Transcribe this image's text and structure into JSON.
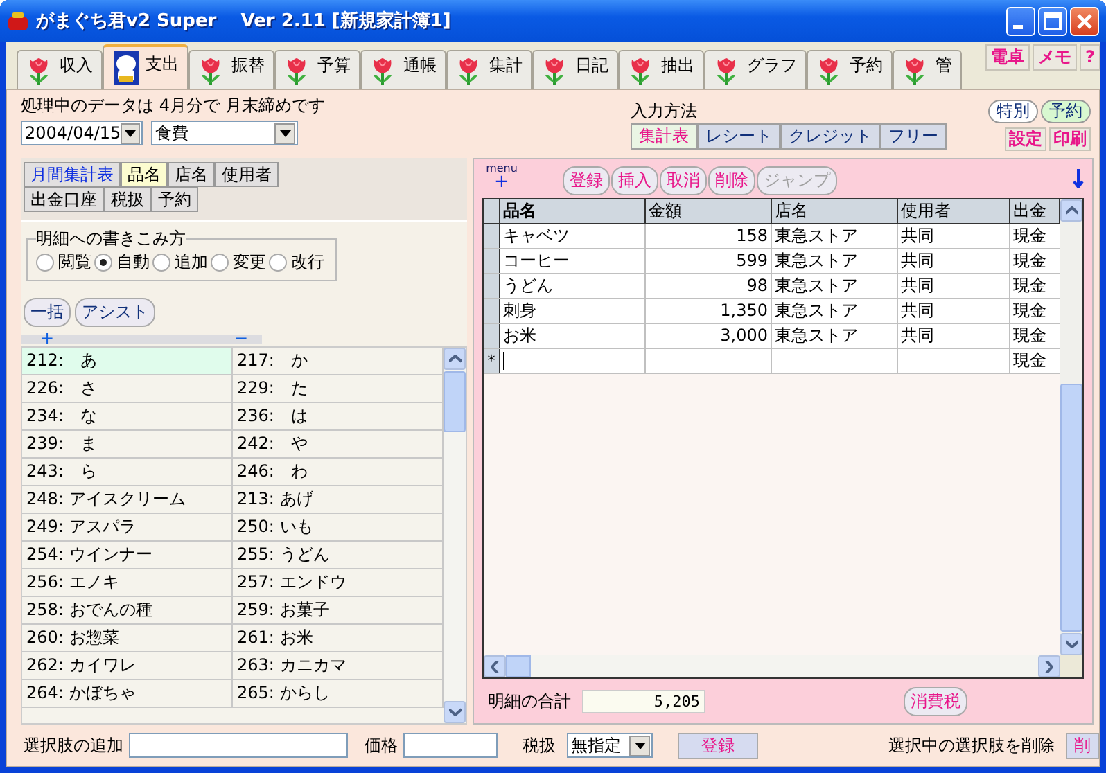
{
  "window": {
    "title": "がまぐち君v2 Super　 Ver 2.11 [新規家計簿1]"
  },
  "tabs": [
    {
      "label": "収入",
      "selected": false,
      "kind": "tulip"
    },
    {
      "label": "支出",
      "selected": true,
      "kind": "figurine"
    },
    {
      "label": "振替",
      "selected": false,
      "kind": "tulip"
    },
    {
      "label": "予算",
      "selected": false,
      "kind": "tulip"
    },
    {
      "label": "通帳",
      "selected": false,
      "kind": "tulip"
    },
    {
      "label": "集計",
      "selected": false,
      "kind": "tulip"
    },
    {
      "label": "日記",
      "selected": false,
      "kind": "tulip"
    },
    {
      "label": "抽出",
      "selected": false,
      "kind": "tulip"
    },
    {
      "label": "グラフ",
      "selected": false,
      "kind": "tulip"
    },
    {
      "label": "予約",
      "selected": false,
      "kind": "tulip"
    },
    {
      "label": "管",
      "selected": false,
      "kind": "tulip"
    }
  ],
  "tool_buttons": [
    "電卓",
    "メモ",
    "?"
  ],
  "status_text": "処理中のデータは 4月分で 月末締めです",
  "date_select": {
    "value": "2004/04/15"
  },
  "category_select": {
    "value": "食費"
  },
  "input_method": {
    "label": "入力方法",
    "options": [
      {
        "label": "集計表",
        "selected": true
      },
      {
        "label": "レシート",
        "selected": false
      },
      {
        "label": "クレジット",
        "selected": false
      },
      {
        "label": "フリー",
        "selected": false
      }
    ]
  },
  "mode_buttons": [
    {
      "label": "特別",
      "color": "#ffffff"
    },
    {
      "label": "予約",
      "color": "#d8f8d0"
    }
  ],
  "action_buttons": [
    "設定",
    "印刷"
  ],
  "view_tabs": [
    {
      "label": "月間集計表",
      "selected": false,
      "kind": "summary"
    },
    {
      "label": "品名",
      "selected": true,
      "kind": "filter"
    },
    {
      "label": "店名",
      "selected": false,
      "kind": "filter"
    },
    {
      "label": "使用者",
      "selected": false,
      "kind": "filter"
    },
    {
      "label": "出金口座",
      "selected": false,
      "kind": "filter"
    },
    {
      "label": "税扱",
      "selected": false,
      "kind": "filter"
    },
    {
      "label": "予約",
      "selected": false,
      "kind": "filter"
    }
  ],
  "write_mode": {
    "legend": "明細への書きこみ方",
    "options": [
      {
        "label": "閲覧",
        "selected": false
      },
      {
        "label": "自動",
        "selected": true
      },
      {
        "label": "追加",
        "selected": false
      },
      {
        "label": "変更",
        "selected": false
      },
      {
        "label": "改行",
        "selected": false
      }
    ]
  },
  "left_buttons": [
    "一括",
    "アシスト"
  ],
  "list_controls": {
    "expand": "+",
    "collapse": "−"
  },
  "item_list": [
    [
      {
        "text": "212:　あ",
        "selected": true
      },
      {
        "text": "217:　か",
        "selected": false
      }
    ],
    [
      {
        "text": "226:　さ",
        "selected": false
      },
      {
        "text": "229:　た",
        "selected": false
      }
    ],
    [
      {
        "text": "234:　な",
        "selected": false
      },
      {
        "text": "236:　は",
        "selected": false
      }
    ],
    [
      {
        "text": "239:　ま",
        "selected": false
      },
      {
        "text": "242:　や",
        "selected": false
      }
    ],
    [
      {
        "text": "243:　ら",
        "selected": false
      },
      {
        "text": "246:　わ",
        "selected": false
      }
    ],
    [
      {
        "text": "248: アイスクリーム",
        "selected": false
      },
      {
        "text": "213: あげ",
        "selected": false
      }
    ],
    [
      {
        "text": "249: アスパラ",
        "selected": false
      },
      {
        "text": "250: いも",
        "selected": false
      }
    ],
    [
      {
        "text": "254: ウインナー",
        "selected": false
      },
      {
        "text": "255: うどん",
        "selected": false
      }
    ],
    [
      {
        "text": "256: エノキ",
        "selected": false
      },
      {
        "text": "257: エンドウ",
        "selected": false
      }
    ],
    [
      {
        "text": "258: おでんの種",
        "selected": false
      },
      {
        "text": "259: お菓子",
        "selected": false
      }
    ],
    [
      {
        "text": "260: お惣菜",
        "selected": false
      },
      {
        "text": "261: お米",
        "selected": false
      }
    ],
    [
      {
        "text": "262: カイワレ",
        "selected": false
      },
      {
        "text": "263: カニカマ",
        "selected": false
      }
    ],
    [
      {
        "text": "264: かぼちゃ",
        "selected": false
      },
      {
        "text": "265: からし",
        "selected": false
      }
    ]
  ],
  "grid_menu": {
    "label": "menu",
    "add": "+"
  },
  "grid_buttons": [
    {
      "label": "登録",
      "disabled": false
    },
    {
      "label": "挿入",
      "disabled": false
    },
    {
      "label": "取消",
      "disabled": false
    },
    {
      "label": "削除",
      "disabled": false
    },
    {
      "label": "ジャンプ",
      "disabled": true
    }
  ],
  "grid": {
    "columns": [
      "品名",
      "金額",
      "店名",
      "使用者",
      "出金"
    ],
    "rows": [
      [
        "キャベツ",
        "158",
        "東急ストア",
        "共同",
        "現金"
      ],
      [
        "コーヒー",
        "599",
        "東急ストア",
        "共同",
        "現金"
      ],
      [
        "うどん",
        "98",
        "東急ストア",
        "共同",
        "現金"
      ],
      [
        "刺身",
        "1,350",
        "東急ストア",
        "共同",
        "現金"
      ],
      [
        "お米",
        "3,000",
        "東急ストア",
        "共同",
        "現金"
      ]
    ],
    "new_row": {
      "marker": "*",
      "account": "現金"
    }
  },
  "total": {
    "label": "明細の合計",
    "value": "5,205"
  },
  "tax_button": "消費税",
  "bottom_bar": {
    "add_label": "選択肢の追加",
    "price_label": "価格",
    "tax_label": "税扱",
    "tax_select": "無指定",
    "register": "登録",
    "delete_label": "選択中の選択肢を削除",
    "delete_button": "削"
  }
}
